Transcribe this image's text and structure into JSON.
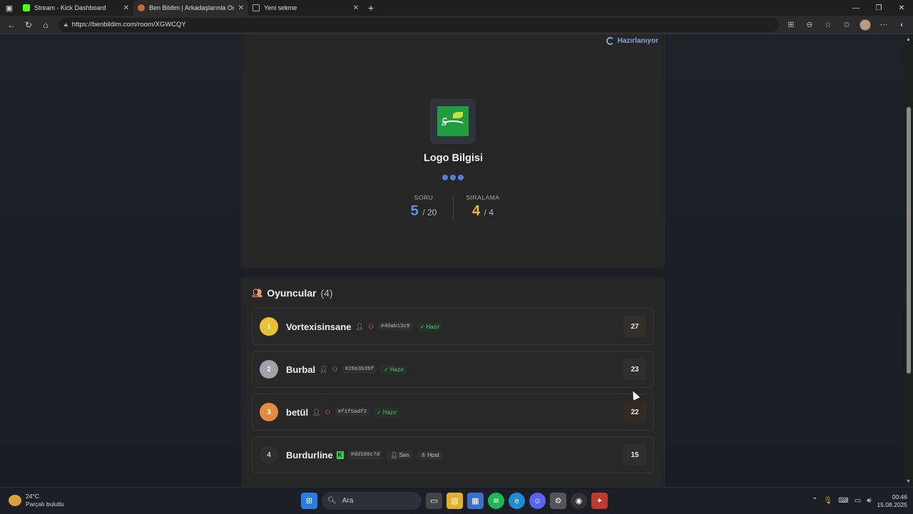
{
  "browser": {
    "tabs": [
      {
        "title": "Stream - Kick Dashboard",
        "color": "#53fc18"
      },
      {
        "title": "Ben Bildim | Arkadaşlarınla Online",
        "color": "#c46a3a"
      },
      {
        "title": "Yeni sekme",
        "color": "#888888"
      }
    ],
    "url": "https://benbildim.com/room/XGWCQY"
  },
  "game": {
    "status": "Hazırlanıyor",
    "category": "Logo Bilgisi",
    "question_label": "SORU",
    "question_current": "5",
    "question_total": "/ 20",
    "rank_label": "SIRALAMA",
    "rank_current": "4",
    "rank_total": "/ 4"
  },
  "players": {
    "title": "Oyuncular",
    "count": "(4)",
    "list": [
      {
        "rank": "1",
        "name": "Vortexisinsane",
        "code": "#40ab13c8",
        "ready": "Hazır",
        "score": "27",
        "rank_color": "#e8c232",
        "score_bg": "#33302a"
      },
      {
        "rank": "2",
        "name": "Burbal",
        "code": "#28e3b39f",
        "ready": "Hazır",
        "score": "23",
        "rank_color": "#9ea3ab",
        "score_bg": "#2f2f2f"
      },
      {
        "rank": "3",
        "name": "betül",
        "code": "#f1f5adf2",
        "ready": "Hazır",
        "score": "22",
        "rank_color": "#e58b3e",
        "score_bg": "#322a24"
      },
      {
        "rank": "4",
        "name": "Burdurline",
        "code": "#dd186c7d",
        "you": "Sen",
        "host": "Host",
        "score": "15",
        "rank_color": "#2f2f2f",
        "score_bg": "#2f2f2f"
      }
    ]
  },
  "taskbar": {
    "temp": "24°C",
    "weather": "Parçalı bulutlu",
    "search": "Ara",
    "time": "00:46",
    "date": "15.08.2025"
  }
}
